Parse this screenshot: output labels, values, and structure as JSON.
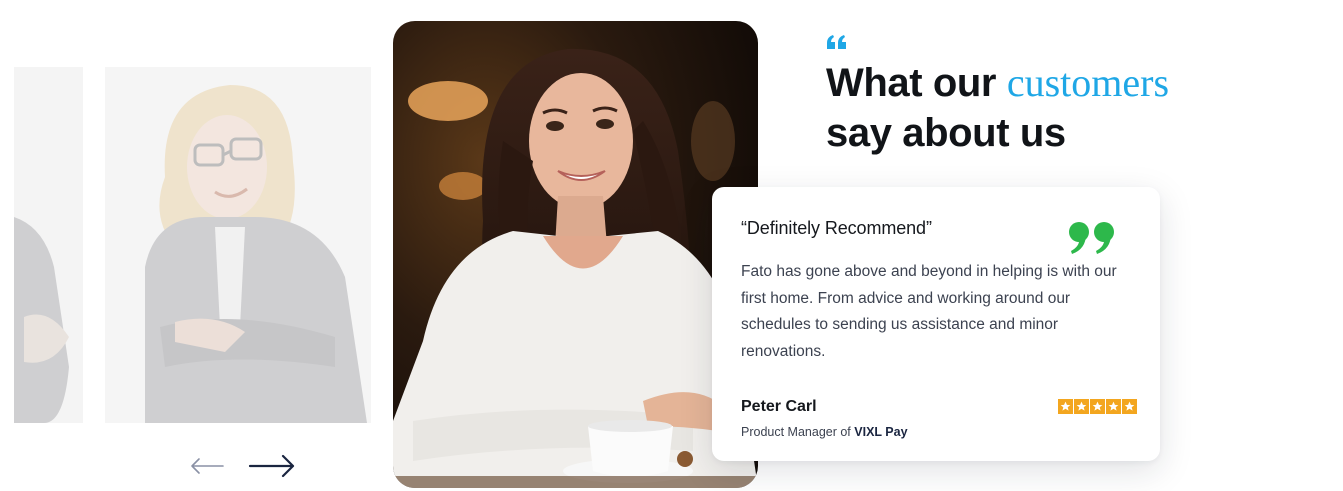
{
  "testimonials": {
    "heading_prefix": "What our",
    "heading_accent": "customers",
    "heading_suffix": "say about us",
    "nav": {
      "prev_icon": "arrow-left-icon",
      "next_icon": "arrow-right-icon"
    },
    "review": {
      "title": "“Definitely Recommend”",
      "body": "Fato has gone above and beyond in helping is with our first home. From advice and working around our schedules to sending us assistance and minor renovations.",
      "reviewer_name": "Peter Carl",
      "reviewer_role_prefix": "Product Manager of",
      "reviewer_company": "VIXL Pay",
      "rating": 5
    },
    "colors": {
      "accent": "#1fa7e6",
      "quote_green": "#2db84b",
      "star": "#f3a61f",
      "heading": "#111418"
    }
  }
}
